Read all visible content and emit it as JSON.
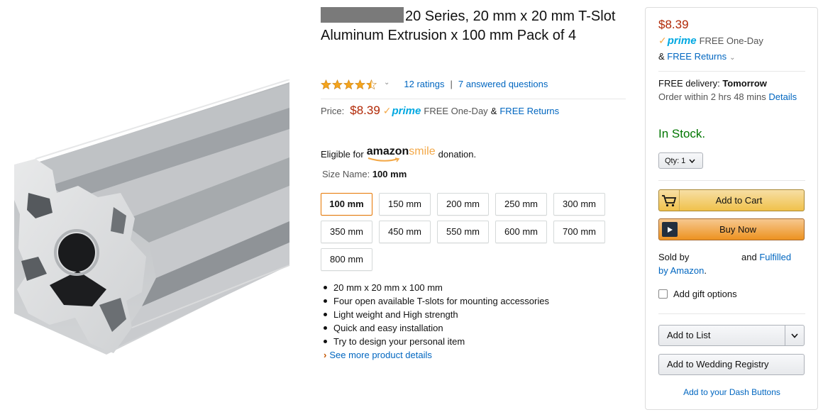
{
  "product": {
    "title": "20 Series, 20 mm x 20 mm T-Slot Aluminum Extrusion x 100 mm Pack of 4",
    "brand_redacted": true,
    "image_icon": "t-slot-aluminum-extrusion-image"
  },
  "rating": {
    "stars": 4.5,
    "ratings_link": "12 ratings",
    "separator": "|",
    "questions_link": "7 answered questions"
  },
  "price_block": {
    "label": "Price:",
    "price": "$8.39",
    "prime": "prime",
    "one_day": "FREE One-Day",
    "amp": "&",
    "returns": "FREE Returns"
  },
  "smile": {
    "prefix": "Eligible for",
    "logo_amazon": "amazon",
    "logo_smile": "smile",
    "suffix": "donation."
  },
  "size": {
    "label": "Size Name:",
    "selected": "100 mm",
    "options": [
      "100 mm",
      "150 mm",
      "200 mm",
      "250 mm",
      "300 mm",
      "350 mm",
      "450 mm",
      "550 mm",
      "600 mm",
      "700 mm",
      "800 mm"
    ]
  },
  "bullets": [
    "20 mm x 20 mm x 100 mm",
    "Four open available T-slots for mounting accessories",
    "Light weight and High strength",
    "Quick and easy installation",
    "Try to design your personal item"
  ],
  "see_more": "See more product details",
  "buybox": {
    "price": "$8.39",
    "prime": "prime",
    "one_day": "FREE One-Day",
    "amp": "&",
    "returns": "FREE Returns",
    "delivery_prefix": "FREE delivery:",
    "delivery_day": "Tomorrow",
    "order_within": "Order within 2 hrs 48 mins",
    "details_link": "Details",
    "stock": "In Stock.",
    "qty_label": "Qty:",
    "qty_value": "1",
    "add_to_cart": "Add to Cart",
    "buy_now": "Buy Now",
    "sold_by": "Sold by",
    "and_text": "and",
    "fulfilled_link_1": "Fulfilled",
    "fulfilled_link_2": "by Amazon",
    "period": ".",
    "gift": "Add gift options",
    "add_to_list": "Add to List",
    "wedding_registry": "Add to Wedding Registry",
    "dash_buttons": "Add to your Dash Buttons"
  },
  "colors": {
    "price_red": "#b12704",
    "link_blue": "#0066c0",
    "prime_blue": "#00a8e1",
    "stock_green": "#007600",
    "cart_yellow": "#f0c14b",
    "buy_orange": "#ed9220",
    "selected_border": "#e77600"
  }
}
